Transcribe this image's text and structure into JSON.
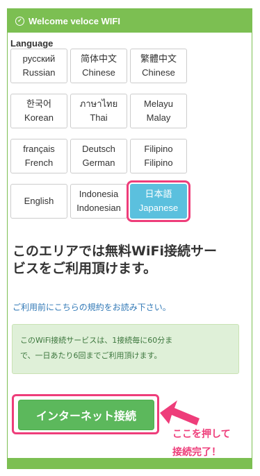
{
  "header": {
    "title": "Welcome veloce WIFI",
    "icon": "check-circle-icon"
  },
  "language": {
    "title": "Language",
    "options": [
      {
        "native": "русский",
        "english": "Russian"
      },
      {
        "native": "简体中文",
        "english": "Chinese"
      },
      {
        "native": "繁體中文",
        "english": "Chinese"
      },
      {
        "native": "한국어",
        "english": "Korean"
      },
      {
        "native": "ภาษาไทย",
        "english": "Thai"
      },
      {
        "native": "Melayu",
        "english": "Malay"
      },
      {
        "native": "français",
        "english": "French"
      },
      {
        "native": "Deutsch",
        "english": "German"
      },
      {
        "native": "Filipino",
        "english": "Filipino"
      },
      {
        "native": "English",
        "english": ""
      },
      {
        "native": "Indonesia",
        "english": "Indonesian"
      },
      {
        "native": "日本語",
        "english": "Japanese"
      }
    ],
    "selected": "Japanese"
  },
  "main": {
    "headline_line1": "このエリアでは無料WiFi接続サー",
    "headline_line2": "ビスをご利用頂けます。",
    "tos_link": "ご利用前にこちらの規約をお読み下さい。",
    "notice_line1": "このWiFi接続サービスは、1接続毎に60分ま",
    "notice_line2": "で、一日あたり6回までご利用頂けます。",
    "connect_button": "インターネット接続"
  },
  "annotation": {
    "line1": "ここを押して",
    "line2": "接続完了！"
  },
  "colors": {
    "green": "#7cbf52",
    "button_green": "#5cb85c",
    "highlight": "#ee3d7a",
    "selected": "#5bc0de"
  }
}
